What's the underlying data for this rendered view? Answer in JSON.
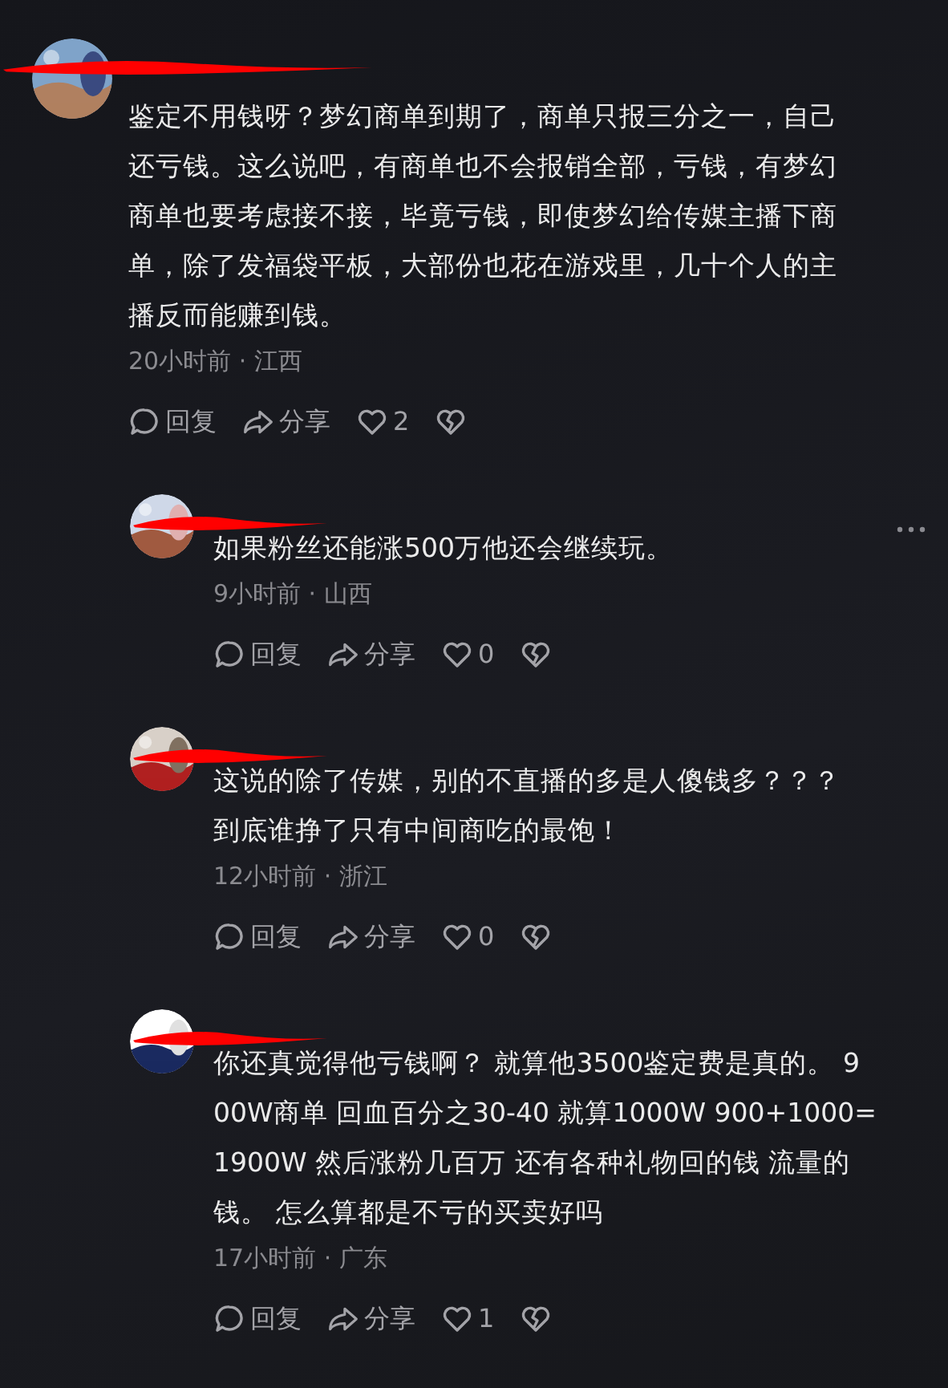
{
  "comment": {
    "avatar": {
      "kind": "picture"
    },
    "more_menu": false,
    "lines": [
      "鉴定不用钱呀？梦幻商单到期了，商单只报三分之一，自己",
      "还亏钱。这么说吧，有商单也不会报销全部，亏钱，有梦幻",
      "商单也要考虑接不接，毕竟亏钱，即使梦幻给传媒主播下商",
      "单，除了发福袋平板，大部份也花在游戏里，几十个人的主",
      "播反而能赚到钱。"
    ],
    "meta": "20小时前 · 江西",
    "reply": "回复",
    "share": "分享",
    "likes": "2",
    "replies": [
      {
        "avatar": {
          "kind": "picture"
        },
        "more_menu": true,
        "lines": [
          "如果粉丝还能涨500万他还会继续玩。"
        ],
        "meta": "9小时前 · 山西",
        "reply": "回复",
        "share": "分享",
        "likes": "0"
      },
      {
        "avatar": {
          "kind": "picture"
        },
        "more_menu": false,
        "lines": [
          "这说的除了传媒，别的不直播的多是人傻钱多？？？",
          "到底谁挣了只有中间商吃的最饱！"
        ],
        "meta": "12小时前 · 浙江",
        "reply": "回复",
        "share": "分享",
        "likes": "0"
      },
      {
        "avatar": {
          "kind": "picture"
        },
        "more_menu": false,
        "lines": [
          "你还真觉得他亏钱啊？  就算他3500鉴定费是真的。 9",
          "00W商单  回血百分之30-40 就算1000W  900+1000=",
          "1900W 然后涨粉几百万  还有各种礼物回的钱 流量的",
          "钱。 怎么算都是不亏的买卖好吗"
        ],
        "meta": "17小时前 · 广东",
        "reply": "回复",
        "share": "分享",
        "likes": "1"
      }
    ]
  }
}
